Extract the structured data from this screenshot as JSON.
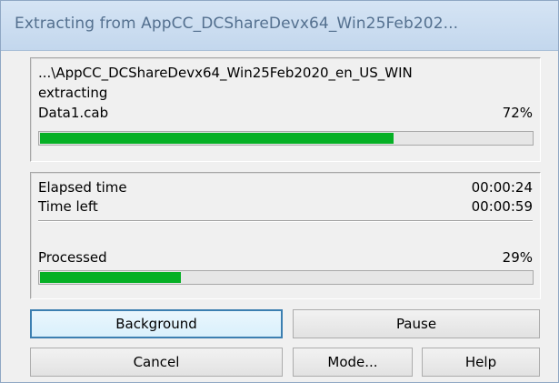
{
  "window": {
    "title": "Extracting from AppCC_DCShareDevx64_Win25Feb202..."
  },
  "file_progress": {
    "path": "...\\AppCC_DCShareDevx64_Win25Feb2020_en_US_WIN",
    "status": "extracting",
    "current_file": "Data1.cab",
    "percent_label": "72%",
    "percent": 72
  },
  "timing": {
    "elapsed_label": "Elapsed time",
    "elapsed_value": "00:00:24",
    "left_label": "Time left",
    "left_value": "00:00:59"
  },
  "total_progress": {
    "label": "Processed",
    "percent_label": "29%",
    "percent": 29
  },
  "buttons": {
    "background": "Background",
    "pause": "Pause",
    "cancel": "Cancel",
    "mode": "Mode...",
    "help": "Help"
  },
  "colors": {
    "progress_fill": "#06b025",
    "default_button_border": "#3c7fb1"
  }
}
